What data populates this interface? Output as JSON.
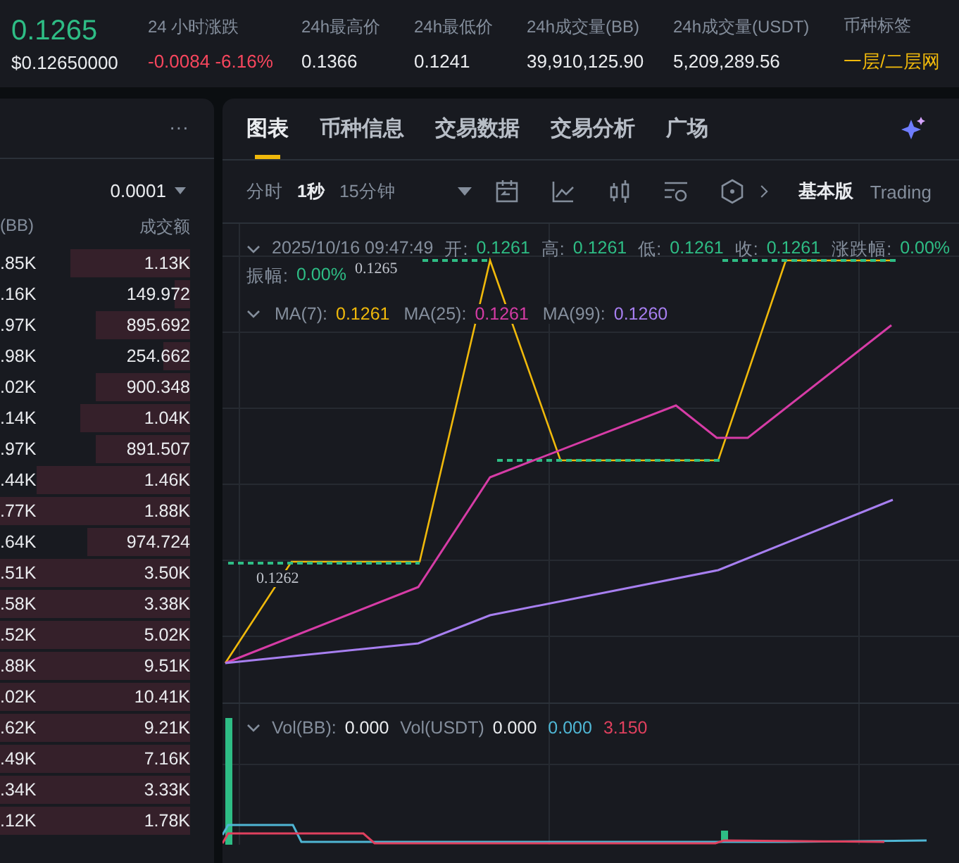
{
  "ticker": {
    "price": "0.1265",
    "price_usd": "$0.12650000",
    "stats": [
      {
        "label": "24 小时涨跌",
        "value": "-0.0084 -6.16%",
        "kind": "down"
      },
      {
        "label": "24h最高价",
        "value": "0.1366",
        "kind": "plain"
      },
      {
        "label": "24h最低价",
        "value": "0.1241",
        "kind": "plain"
      },
      {
        "label": "24h成交量(BB)",
        "value": "39,910,125.90",
        "kind": "plain"
      },
      {
        "label": "24h成交量(USDT)",
        "value": "5,209,289.56",
        "kind": "plain"
      },
      {
        "label": "币种标签",
        "value": "一层/二层网",
        "kind": "tag"
      }
    ]
  },
  "order_book": {
    "more": "···",
    "precision": "0.0001",
    "columns": [
      "(BB)",
      "成交额"
    ],
    "rows": [
      {
        "amount": ".85K",
        "total": "1.13K",
        "level": 0.63
      },
      {
        "amount": ".16K",
        "total": "149.972",
        "level": 0.08
      },
      {
        "amount": ".97K",
        "total": "895.692",
        "level": 0.5
      },
      {
        "amount": ".98K",
        "total": "254.662",
        "level": 0.14
      },
      {
        "amount": ".02K",
        "total": "900.348",
        "level": 0.5
      },
      {
        "amount": ".14K",
        "total": "1.04K",
        "level": 0.58
      },
      {
        "amount": ".97K",
        "total": "891.507",
        "level": 0.5
      },
      {
        "amount": ".44K",
        "total": "1.46K",
        "level": 0.81
      },
      {
        "amount": ".77K",
        "total": "1.88K",
        "level": 1
      },
      {
        "amount": ".64K",
        "total": "974.724",
        "level": 0.54
      },
      {
        "amount": ".51K",
        "total": "3.50K",
        "level": 1
      },
      {
        "amount": ".58K",
        "total": "3.38K",
        "level": 1
      },
      {
        "amount": ".52K",
        "total": "5.02K",
        "level": 1
      },
      {
        "amount": ".88K",
        "total": "9.51K",
        "level": 1
      },
      {
        "amount": ".02K",
        "total": "10.41K",
        "level": 1
      },
      {
        "amount": ".62K",
        "total": "9.21K",
        "level": 1
      },
      {
        "amount": ".49K",
        "total": "7.16K",
        "level": 1
      },
      {
        "amount": ".34K",
        "total": "3.33K",
        "level": 1
      },
      {
        "amount": ".12K",
        "total": "1.78K",
        "level": 1
      }
    ]
  },
  "tabs": [
    {
      "label": "图表",
      "selected": true
    },
    {
      "label": "币种信息",
      "selected": false
    },
    {
      "label": "交易数据",
      "selected": false
    },
    {
      "label": "交易分析",
      "selected": false
    },
    {
      "label": "广场",
      "selected": false
    }
  ],
  "toolbar": {
    "intervals": [
      {
        "label": "分时",
        "selected": false
      },
      {
        "label": "1秒",
        "selected": true
      },
      {
        "label": "15分钟",
        "selected": false
      }
    ],
    "versions": [
      {
        "label": "基本版",
        "selected": true
      },
      {
        "label": "Trading",
        "selected": false
      }
    ]
  },
  "chart": {
    "legend": [
      {
        "label": "2025/10/16 09:47:49"
      },
      {
        "label": "开:",
        "value": "0.1261"
      },
      {
        "label": "高:",
        "value": "0.1261"
      },
      {
        "label": "低:",
        "value": "0.1261"
      },
      {
        "label": "收:",
        "value": "0.1261"
      },
      {
        "label": "涨跌幅:",
        "value": "0.00%"
      },
      {
        "label": "振幅:",
        "value": "0.00%"
      }
    ],
    "ma": [
      {
        "label": "MA(7):",
        "value": "0.1261",
        "color": "#f0b90b"
      },
      {
        "label": "MA(25):",
        "value": "0.1261",
        "color": "#d63ca6"
      },
      {
        "label": "MA(99):",
        "value": "0.1260",
        "color": "#a77ff0"
      }
    ],
    "high_label": "0.1265",
    "low_label": "0.1262",
    "volume": [
      {
        "label": "Vol(BB):",
        "value": "0.000",
        "color": "#eaecef"
      },
      {
        "label": "Vol(USDT)",
        "value": "0.000",
        "color": "#eaecef"
      },
      {
        "value": "0.000",
        "color": "#4fb6d4"
      },
      {
        "value": "3.150",
        "color": "#e0405e"
      }
    ]
  }
}
